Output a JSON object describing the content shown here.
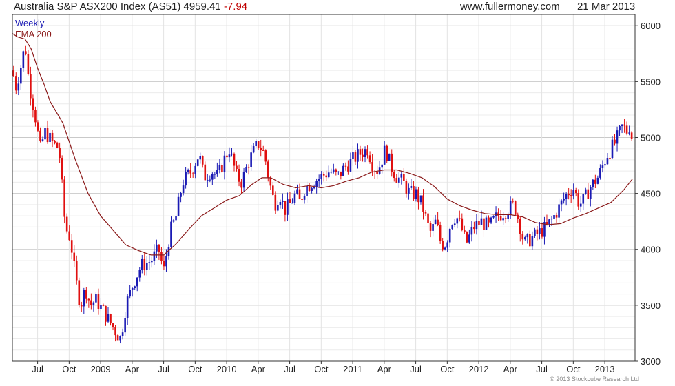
{
  "header": {
    "title": "Australia S&P ASX200 Index (AS51) 4959.41",
    "change": "-7.94",
    "site": "www.fullermoney.com",
    "date": "21 Mar 2013"
  },
  "credit": "© 2013 Stockcube Research Ltd",
  "chart_data": {
    "type": "candlestick",
    "legend": [
      {
        "label": "Weekly",
        "color": "#1a1ab4"
      },
      {
        "label": "EMA 200",
        "color": "#8b1a1a"
      }
    ],
    "legend_position": "top-left",
    "grid": true,
    "ylim": [
      3000,
      6100
    ],
    "y_ticks": [
      3000,
      3500,
      4000,
      4500,
      5000,
      5500,
      6000
    ],
    "x_range": [
      2008.3,
      2013.24
    ],
    "x_ticks": [
      {
        "label": "Jul",
        "t": 2008.5
      },
      {
        "label": "Oct",
        "t": 2008.75
      },
      {
        "label": "2009",
        "t": 2009.0
      },
      {
        "label": "Apr",
        "t": 2009.25
      },
      {
        "label": "Jul",
        "t": 2009.5
      },
      {
        "label": "Oct",
        "t": 2009.75
      },
      {
        "label": "2010",
        "t": 2010.0
      },
      {
        "label": "Apr",
        "t": 2010.25
      },
      {
        "label": "Jul",
        "t": 2010.5
      },
      {
        "label": "Oct",
        "t": 2010.75
      },
      {
        "label": "2011",
        "t": 2011.0
      },
      {
        "label": "Apr",
        "t": 2011.25
      },
      {
        "label": "Jul",
        "t": 2011.5
      },
      {
        "label": "Oct",
        "t": 2011.75
      },
      {
        "label": "2012",
        "t": 2012.0
      },
      {
        "label": "Apr",
        "t": 2012.25
      },
      {
        "label": "Jul",
        "t": 2012.5
      },
      {
        "label": "Oct",
        "t": 2012.75
      },
      {
        "label": "2013",
        "t": 2013.0
      }
    ],
    "up_color": "#1a1ab4",
    "down_color": "#e01010",
    "ema_color": "#8b1a1a",
    "close_anchors": [
      [
        2008.3,
        5600
      ],
      [
        2008.33,
        5450
      ],
      [
        2008.38,
        5700
      ],
      [
        2008.4,
        5850
      ],
      [
        2008.43,
        5500
      ],
      [
        2008.48,
        5200
      ],
      [
        2008.52,
        4900
      ],
      [
        2008.56,
        5050
      ],
      [
        2008.62,
        4950
      ],
      [
        2008.67,
        4900
      ],
      [
        2008.72,
        4200
      ],
      [
        2008.76,
        4100
      ],
      [
        2008.8,
        3750
      ],
      [
        2008.84,
        3500
      ],
      [
        2008.88,
        3650
      ],
      [
        2008.92,
        3500
      ],
      [
        2008.96,
        3550
      ],
      [
        2009.02,
        3450
      ],
      [
        2009.1,
        3300
      ],
      [
        2009.16,
        3200
      ],
      [
        2009.2,
        3500
      ],
      [
        2009.26,
        3700
      ],
      [
        2009.32,
        3850
      ],
      [
        2009.4,
        3900
      ],
      [
        2009.46,
        4000
      ],
      [
        2009.5,
        3800
      ],
      [
        2009.55,
        4150
      ],
      [
        2009.6,
        4300
      ],
      [
        2009.65,
        4600
      ],
      [
        2009.72,
        4700
      ],
      [
        2009.78,
        4850
      ],
      [
        2009.82,
        4650
      ],
      [
        2009.88,
        4700
      ],
      [
        2009.93,
        4650
      ],
      [
        2009.98,
        4800
      ],
      [
        2010.02,
        4900
      ],
      [
        2010.08,
        4650
      ],
      [
        2010.12,
        4600
      ],
      [
        2010.18,
        4800
      ],
      [
        2010.25,
        4950
      ],
      [
        2010.3,
        4850
      ],
      [
        2010.34,
        4600
      ],
      [
        2010.38,
        4400
      ],
      [
        2010.42,
        4500
      ],
      [
        2010.46,
        4350
      ],
      [
        2010.5,
        4400
      ],
      [
        2010.55,
        4500
      ],
      [
        2010.58,
        4420
      ],
      [
        2010.62,
        4550
      ],
      [
        2010.68,
        4600
      ],
      [
        2010.75,
        4650
      ],
      [
        2010.82,
        4700
      ],
      [
        2010.88,
        4650
      ],
      [
        2010.95,
        4750
      ],
      [
        2011.0,
        4800
      ],
      [
        2011.05,
        4850
      ],
      [
        2011.12,
        4900
      ],
      [
        2011.16,
        4750
      ],
      [
        2011.2,
        4700
      ],
      [
        2011.26,
        4900
      ],
      [
        2011.3,
        4750
      ],
      [
        2011.35,
        4650
      ],
      [
        2011.4,
        4600
      ],
      [
        2011.45,
        4500
      ],
      [
        2011.5,
        4500
      ],
      [
        2011.55,
        4400
      ],
      [
        2011.6,
        4200
      ],
      [
        2011.62,
        4150
      ],
      [
        2011.66,
        4250
      ],
      [
        2011.7,
        4050
      ],
      [
        2011.74,
        4050
      ],
      [
        2011.78,
        4250
      ],
      [
        2011.82,
        4300
      ],
      [
        2011.86,
        4200
      ],
      [
        2011.9,
        4050
      ],
      [
        2011.96,
        4200
      ],
      [
        2012.02,
        4250
      ],
      [
        2012.08,
        4200
      ],
      [
        2012.15,
        4300
      ],
      [
        2012.22,
        4350
      ],
      [
        2012.28,
        4400
      ],
      [
        2012.32,
        4250
      ],
      [
        2012.36,
        4050
      ],
      [
        2012.42,
        4100
      ],
      [
        2012.48,
        4150
      ],
      [
        2012.54,
        4200
      ],
      [
        2012.6,
        4300
      ],
      [
        2012.65,
        4400
      ],
      [
        2012.7,
        4500
      ],
      [
        2012.75,
        4550
      ],
      [
        2012.8,
        4400
      ],
      [
        2012.84,
        4450
      ],
      [
        2012.88,
        4550
      ],
      [
        2012.95,
        4650
      ],
      [
        2013.02,
        4850
      ],
      [
        2013.08,
        4950
      ],
      [
        2013.14,
        5100
      ],
      [
        2013.18,
        5050
      ],
      [
        2013.2,
        5120
      ],
      [
        2013.22,
        4959
      ]
    ],
    "ema_200": [
      [
        2008.3,
        5930
      ],
      [
        2008.34,
        5900
      ],
      [
        2008.4,
        5880
      ],
      [
        2008.45,
        5790
      ],
      [
        2008.5,
        5620
      ],
      [
        2008.55,
        5480
      ],
      [
        2008.6,
        5320
      ],
      [
        2008.7,
        5130
      ],
      [
        2008.8,
        4800
      ],
      [
        2008.9,
        4500
      ],
      [
        2009.0,
        4300
      ],
      [
        2009.1,
        4170
      ],
      [
        2009.2,
        4040
      ],
      [
        2009.3,
        3990
      ],
      [
        2009.4,
        3950
      ],
      [
        2009.5,
        3950
      ],
      [
        2009.6,
        4050
      ],
      [
        2009.7,
        4180
      ],
      [
        2009.8,
        4300
      ],
      [
        2009.9,
        4370
      ],
      [
        2010.0,
        4440
      ],
      [
        2010.1,
        4480
      ],
      [
        2010.2,
        4580
      ],
      [
        2010.28,
        4640
      ],
      [
        2010.35,
        4640
      ],
      [
        2010.45,
        4580
      ],
      [
        2010.55,
        4550
      ],
      [
        2010.65,
        4570
      ],
      [
        2010.75,
        4550
      ],
      [
        2010.85,
        4570
      ],
      [
        2010.95,
        4610
      ],
      [
        2011.05,
        4640
      ],
      [
        2011.15,
        4690
      ],
      [
        2011.25,
        4710
      ],
      [
        2011.35,
        4710
      ],
      [
        2011.45,
        4680
      ],
      [
        2011.55,
        4640
      ],
      [
        2011.65,
        4560
      ],
      [
        2011.75,
        4450
      ],
      [
        2011.85,
        4390
      ],
      [
        2011.95,
        4350
      ],
      [
        2012.05,
        4320
      ],
      [
        2012.15,
        4310
      ],
      [
        2012.25,
        4310
      ],
      [
        2012.35,
        4290
      ],
      [
        2012.45,
        4240
      ],
      [
        2012.55,
        4220
      ],
      [
        2012.65,
        4230
      ],
      [
        2012.75,
        4280
      ],
      [
        2012.85,
        4320
      ],
      [
        2012.95,
        4370
      ],
      [
        2013.05,
        4420
      ],
      [
        2013.15,
        4530
      ],
      [
        2013.22,
        4630
      ]
    ]
  }
}
